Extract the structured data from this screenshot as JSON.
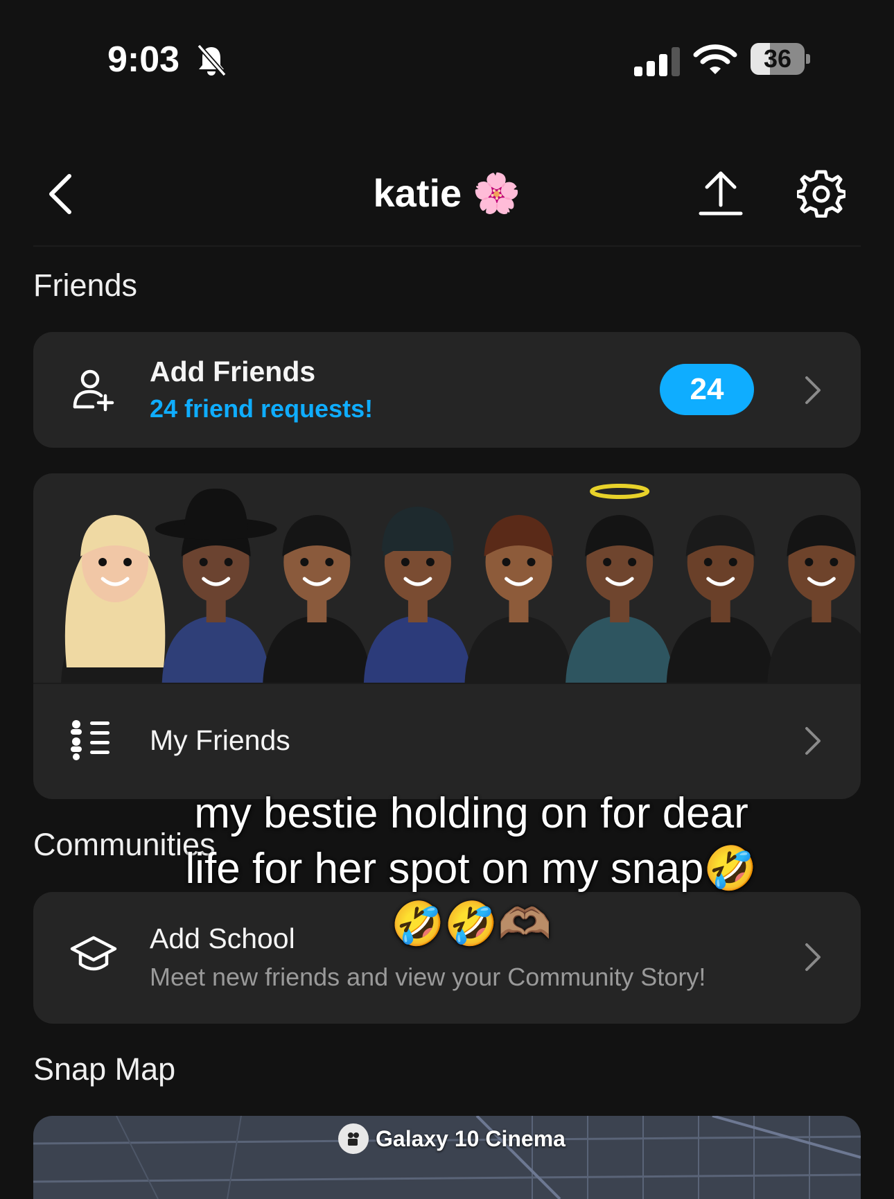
{
  "status_bar": {
    "time": "9:03",
    "battery_percent": "36",
    "battery_level": 0.36
  },
  "header": {
    "title": "katie 🌸"
  },
  "friends": {
    "section_label": "Friends",
    "add_friends": {
      "title": "Add Friends",
      "subtitle": "24 friend requests!",
      "badge": "24"
    },
    "my_friends": {
      "title": "My Friends"
    },
    "avatars": [
      {
        "skin": "#f1c7a6",
        "hair": "#efd9a3",
        "outfit": "#1a1a1a",
        "hat": "none"
      },
      {
        "skin": "#6b4330",
        "hair": "#111111",
        "outfit": "#2f3f78",
        "hat": "cowboy"
      },
      {
        "skin": "#8a5a3c",
        "hair": "#151515",
        "outfit": "#151515",
        "hat": "none"
      },
      {
        "skin": "#7a4c32",
        "hair": "#1e2a2e",
        "outfit": "#2c3b7a",
        "hat": "durag"
      },
      {
        "skin": "#8d5b3a",
        "hair": "#5a2a18",
        "outfit": "#1b1b1b",
        "hat": "none"
      },
      {
        "skin": "#6f452e",
        "hair": "#141414",
        "outfit": "#2e5560",
        "hat": "halo"
      },
      {
        "skin": "#6a4029",
        "hair": "#1a1a1a",
        "outfit": "#161616",
        "hat": "none"
      },
      {
        "skin": "#6e432b",
        "hair": "#141414",
        "outfit": "#1b1b1b",
        "hat": "none"
      }
    ]
  },
  "communities": {
    "section_label": "Communities",
    "add_school": {
      "title": "Add School",
      "subtitle": "Meet new friends and view your Community Story!"
    }
  },
  "snap_map": {
    "section_label": "Snap Map",
    "place_label": "Galaxy 10 Cinema"
  },
  "overlay_caption": {
    "line1": "my bestie holding on for dear",
    "line2": "life for her spot on my snap🤣",
    "line3": "🤣🤣🫶🏽"
  },
  "colors": {
    "background": "#121212",
    "card": "#252525",
    "accent": "#0fadff"
  }
}
